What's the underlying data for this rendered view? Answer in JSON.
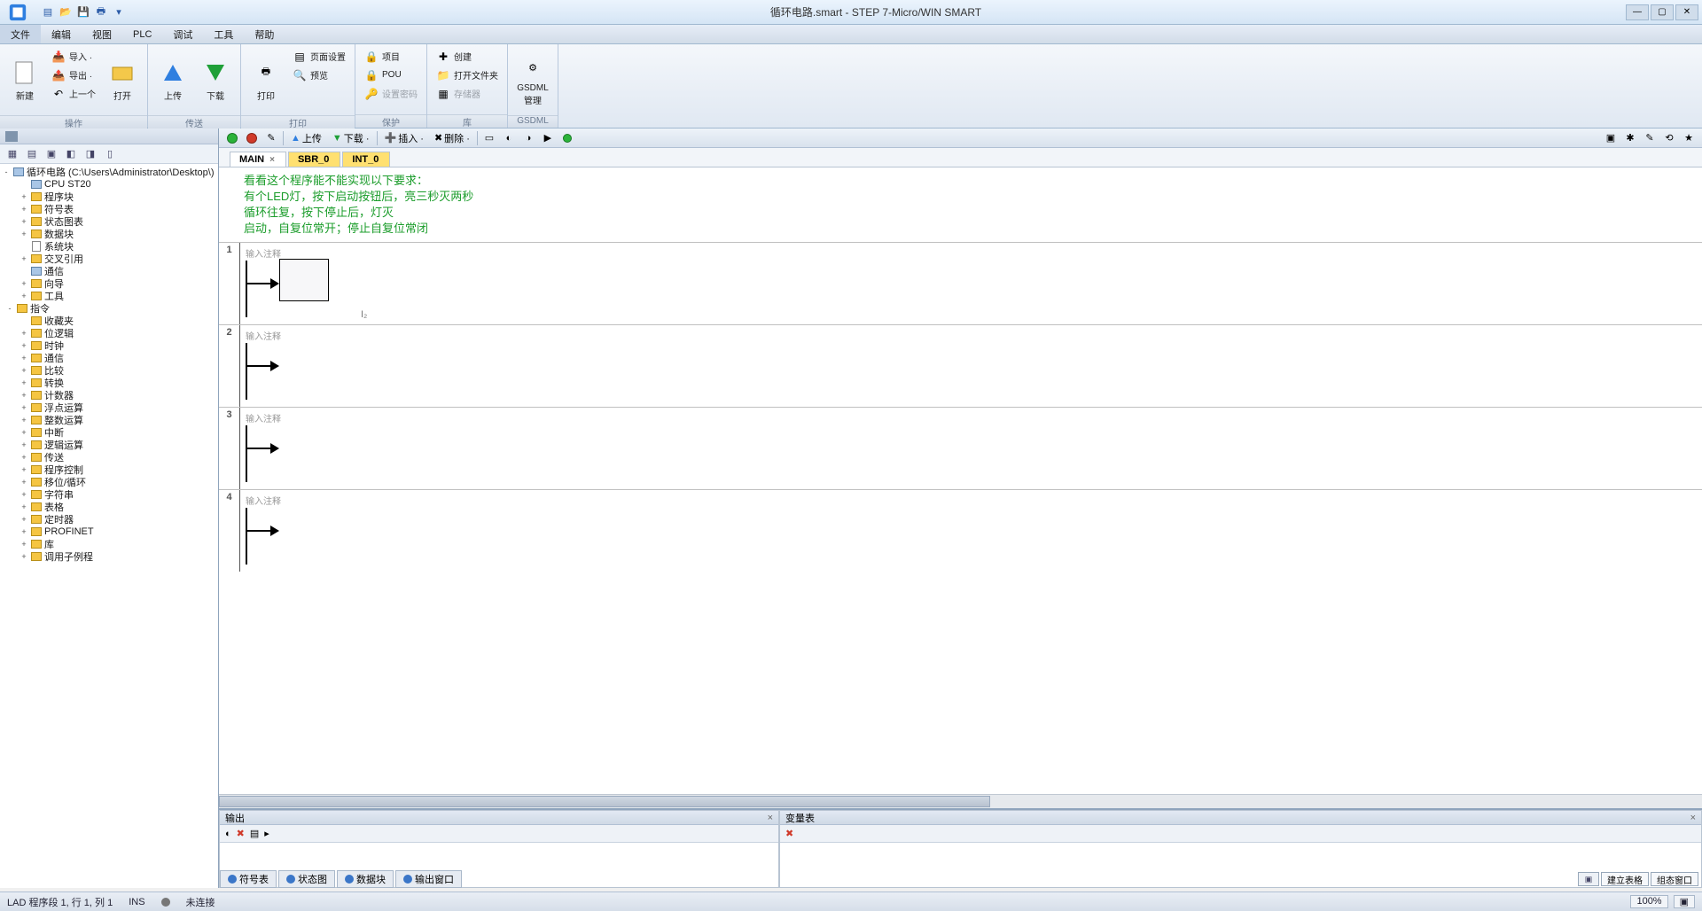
{
  "title": "循环电路.smart - STEP 7-Micro/WIN SMART",
  "menu": {
    "items": [
      "文件",
      "编辑",
      "视图",
      "PLC",
      "调试",
      "工具",
      "帮助"
    ],
    "active": 0
  },
  "ribbon": {
    "groups": [
      {
        "label": "操作",
        "big": [
          {
            "key": "new",
            "label": "新建"
          },
          {
            "key": "open",
            "label": "打开"
          }
        ],
        "small": [
          {
            "key": "import",
            "label": "导入 ·"
          },
          {
            "key": "export",
            "label": "导出 ·"
          },
          {
            "key": "prev",
            "label": "上一个"
          }
        ]
      },
      {
        "label": "传送",
        "big": [
          {
            "key": "upload",
            "label": "上传"
          },
          {
            "key": "download",
            "label": "下载"
          }
        ]
      },
      {
        "label": "打印",
        "big": [
          {
            "key": "print",
            "label": "打印"
          }
        ],
        "small": [
          {
            "key": "pgset",
            "label": "页面设置"
          },
          {
            "key": "preview",
            "label": "预览"
          }
        ]
      },
      {
        "label": "保护",
        "small": [
          {
            "key": "proj",
            "label": "项目"
          },
          {
            "key": "pou",
            "label": "POU"
          },
          {
            "key": "setpw",
            "label": "设置密码",
            "disabled": true
          }
        ]
      },
      {
        "label": "库",
        "small": [
          {
            "key": "create",
            "label": "创建"
          },
          {
            "key": "openlib",
            "label": "打开文件夹"
          },
          {
            "key": "memlib",
            "label": "存储器",
            "disabled": true
          }
        ]
      },
      {
        "label": "GSDML",
        "big": [
          {
            "key": "gsdml",
            "label": "GSDML\n管理"
          }
        ]
      }
    ]
  },
  "tree": {
    "root": "循环电路 (C:\\Users\\Administrator\\Desktop\\)",
    "nodes": [
      {
        "d": 1,
        "exp": "",
        "ico": "chip",
        "label": "CPU ST20"
      },
      {
        "d": 1,
        "exp": "+",
        "ico": "folder",
        "label": "程序块"
      },
      {
        "d": 1,
        "exp": "+",
        "ico": "folder",
        "label": "符号表"
      },
      {
        "d": 1,
        "exp": "+",
        "ico": "folder",
        "label": "状态图表"
      },
      {
        "d": 1,
        "exp": "+",
        "ico": "folder",
        "label": "数据块"
      },
      {
        "d": 1,
        "exp": "",
        "ico": "doc",
        "label": "系统块"
      },
      {
        "d": 1,
        "exp": "+",
        "ico": "folder",
        "label": "交叉引用"
      },
      {
        "d": 1,
        "exp": "",
        "ico": "chip",
        "label": "通信"
      },
      {
        "d": 1,
        "exp": "+",
        "ico": "folder",
        "label": "向导"
      },
      {
        "d": 1,
        "exp": "+",
        "ico": "folder",
        "label": "工具"
      },
      {
        "d": 0,
        "exp": "-",
        "ico": "folder",
        "label": "指令"
      },
      {
        "d": 1,
        "exp": "",
        "ico": "folder",
        "label": "收藏夹"
      },
      {
        "d": 1,
        "exp": "+",
        "ico": "folder",
        "label": "位逻辑"
      },
      {
        "d": 1,
        "exp": "+",
        "ico": "folder",
        "label": "时钟"
      },
      {
        "d": 1,
        "exp": "+",
        "ico": "folder",
        "label": "通信"
      },
      {
        "d": 1,
        "exp": "+",
        "ico": "folder",
        "label": "比较"
      },
      {
        "d": 1,
        "exp": "+",
        "ico": "folder",
        "label": "转换"
      },
      {
        "d": 1,
        "exp": "+",
        "ico": "folder",
        "label": "计数器"
      },
      {
        "d": 1,
        "exp": "+",
        "ico": "folder",
        "label": "浮点运算"
      },
      {
        "d": 1,
        "exp": "+",
        "ico": "folder",
        "label": "整数运算"
      },
      {
        "d": 1,
        "exp": "+",
        "ico": "folder",
        "label": "中断"
      },
      {
        "d": 1,
        "exp": "+",
        "ico": "folder",
        "label": "逻辑运算"
      },
      {
        "d": 1,
        "exp": "+",
        "ico": "folder",
        "label": "传送"
      },
      {
        "d": 1,
        "exp": "+",
        "ico": "folder",
        "label": "程序控制"
      },
      {
        "d": 1,
        "exp": "+",
        "ico": "folder",
        "label": "移位/循环"
      },
      {
        "d": 1,
        "exp": "+",
        "ico": "folder",
        "label": "字符串"
      },
      {
        "d": 1,
        "exp": "+",
        "ico": "folder",
        "label": "表格"
      },
      {
        "d": 1,
        "exp": "+",
        "ico": "folder",
        "label": "定时器"
      },
      {
        "d": 1,
        "exp": "+",
        "ico": "folder",
        "label": "PROFINET"
      },
      {
        "d": 1,
        "exp": "+",
        "ico": "folder",
        "label": "库"
      },
      {
        "d": 1,
        "exp": "+",
        "ico": "folder",
        "label": "调用子例程"
      }
    ]
  },
  "editorToolbar": {
    "upload": "上传",
    "download": "下载 ·",
    "insert": "插入 ·",
    "delete": "删除 ·"
  },
  "tabs": [
    {
      "label": "MAIN",
      "x": true,
      "active": true
    },
    {
      "label": "SBR_0",
      "hl": true
    },
    {
      "label": "INT_0",
      "hl": true
    }
  ],
  "comments": [
    "看看这个程序能不能实现以下要求：",
    "有个LED灯，按下启动按钮后，亮三秒灭两秒",
    "循环往复，按下停止后，灯灭",
    "启动，自复位常开；停止自复位常闭"
  ],
  "networks": [
    {
      "num": "1",
      "title": "输入注释"
    },
    {
      "num": "2",
      "title": "输入注释"
    },
    {
      "num": "3",
      "title": "输入注释"
    },
    {
      "num": "4",
      "title": "输入注释"
    }
  ],
  "bottomPanels": {
    "left": "输出",
    "right": "变量表"
  },
  "bottomTabs": [
    "符号表",
    "状态图",
    "数据块",
    "输出窗口"
  ],
  "viewButtons": {
    "a": "建立表格",
    "b": "组态窗口"
  },
  "status": {
    "left": "LAD  程序段 1, 行 1, 列 1",
    "ins": "INS",
    "conn": "未连接",
    "r1": "100%",
    "r2": "▣"
  }
}
